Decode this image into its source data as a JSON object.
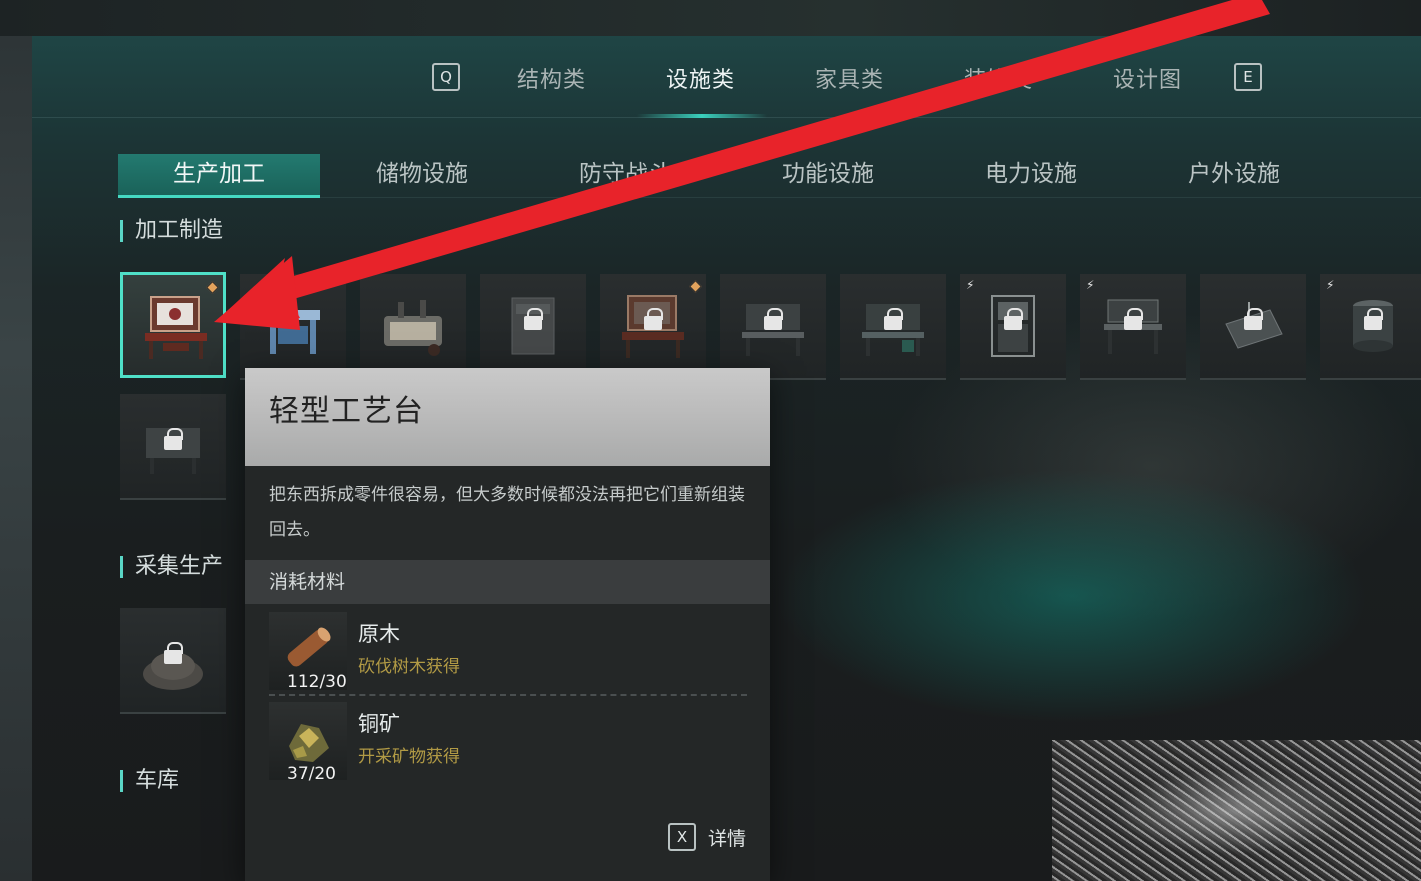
{
  "top_tabs": {
    "left_key": "Q",
    "right_key": "E",
    "tabs": [
      {
        "label": "结构类",
        "active": false
      },
      {
        "label": "设施类",
        "active": true
      },
      {
        "label": "家具类",
        "active": false
      },
      {
        "label": "装饰类",
        "active": false
      },
      {
        "label": "设计图",
        "active": false
      }
    ]
  },
  "sub_tabs": [
    {
      "label": "生产加工",
      "active": true
    },
    {
      "label": "储物设施",
      "active": false
    },
    {
      "label": "防守战斗",
      "active": false
    },
    {
      "label": "功能设施",
      "active": false
    },
    {
      "label": "电力设施",
      "active": false
    },
    {
      "label": "户外设施",
      "active": false
    }
  ],
  "sections": {
    "processing": "加工制造",
    "gathering": "采集生产",
    "garage": "车库"
  },
  "items": [
    {
      "icon": "craft-table-icon",
      "locked": false,
      "badge": "diamond",
      "selected": true
    },
    {
      "icon": "workbench-blue-icon",
      "locked": false,
      "badge": "",
      "selected": false
    },
    {
      "icon": "machine-icon",
      "locked": false,
      "badge": "",
      "selected": false
    },
    {
      "icon": "cabinet-icon",
      "locked": true,
      "badge": "",
      "selected": false
    },
    {
      "icon": "craft-table-2-icon",
      "locked": true,
      "badge": "diamond",
      "selected": false
    },
    {
      "icon": "workstation-icon",
      "locked": true,
      "badge": "",
      "selected": false
    },
    {
      "icon": "workstation-2-icon",
      "locked": true,
      "badge": "",
      "selected": false
    },
    {
      "icon": "electric-cabinet-icon",
      "locked": true,
      "badge": "bolt",
      "selected": false
    },
    {
      "icon": "electric-workbench-icon",
      "locked": true,
      "badge": "bolt",
      "selected": false
    },
    {
      "icon": "drafting-table-icon",
      "locked": true,
      "badge": "",
      "selected": false
    },
    {
      "icon": "electric-barrel-icon",
      "locked": true,
      "badge": "bolt",
      "selected": false
    }
  ],
  "tooltip": {
    "title": "轻型工艺台",
    "description": "把东西拆成零件很容易，但大多数时候都没法再把它们重新组装回去。",
    "materials_header": "消耗材料",
    "materials": [
      {
        "name": "原木",
        "source": "砍伐树木获得",
        "count": "112/30",
        "icon": "log-icon"
      },
      {
        "name": "铜矿",
        "source": "开采矿物获得",
        "count": "37/20",
        "icon": "copper-ore-icon"
      }
    ],
    "detail_key": "X",
    "detail_label": "详情"
  },
  "colors": {
    "accent": "#45d8c2",
    "arrow": "#e8232a",
    "source_text": "#b19a45"
  }
}
